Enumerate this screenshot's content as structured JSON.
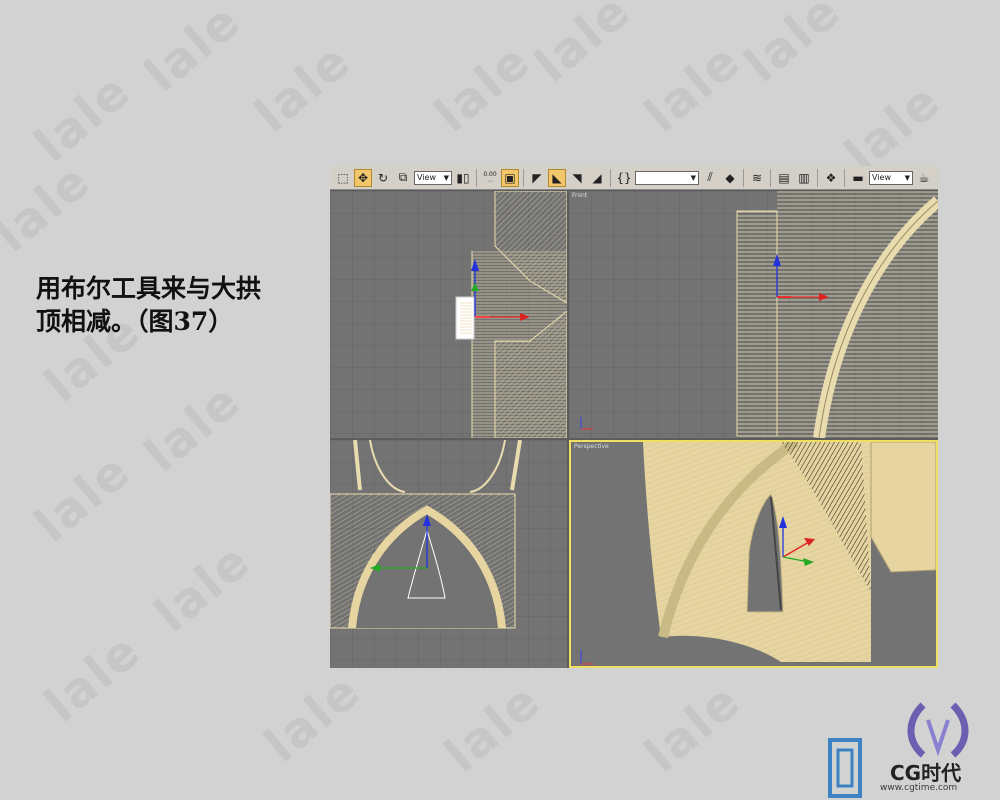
{
  "watermark": "lale",
  "caption": {
    "line1": "用布尔工具来与大拱",
    "line2": "顶相减。（图37）"
  },
  "toolbar": {
    "view_select_1": "View",
    "view_select_2": "View",
    "snap_value": "0.00",
    "named_selection": ""
  },
  "viewports": {
    "front_label": "Front",
    "perspective_label": "Perspective"
  },
  "logo": {
    "brand": "CG时代",
    "url": "www.cgtime.com"
  },
  "colors": {
    "background": "#d2d2d2",
    "viewport_bg": "#737373",
    "wire": "#e8dcae",
    "solid": "#e6d4a1",
    "active_border": "#f0e060",
    "toolbar": "#d4d0c8"
  }
}
